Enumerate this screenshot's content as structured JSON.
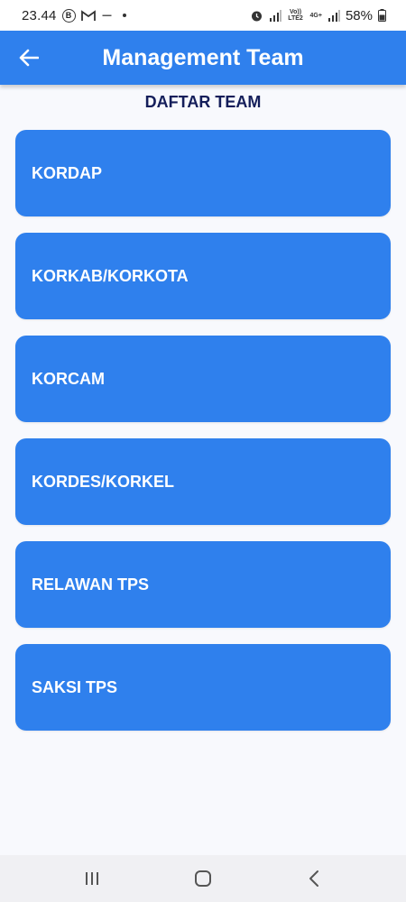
{
  "status_bar": {
    "time": "23.44",
    "app_icons": [
      "b-icon",
      "gmail-icon",
      "notification-icon"
    ],
    "network_label_1": "Vo)) LTE2",
    "network_label_2": "4G+",
    "battery": "58%"
  },
  "app_bar": {
    "title": "Management Team",
    "back_icon": "arrow-left-icon"
  },
  "section": {
    "heading": "DAFTAR TEAM"
  },
  "teams": [
    {
      "label": "KORDAP"
    },
    {
      "label": "KORKAB/KORKOTA"
    },
    {
      "label": "KORCAM"
    },
    {
      "label": "KORDES/KORKEL"
    },
    {
      "label": "RELAWAN TPS"
    },
    {
      "label": "SAKSI TPS"
    }
  ],
  "colors": {
    "primary": "#2f80ed",
    "heading": "#141e5a",
    "background": "#f8f9fd"
  },
  "nav_bar": {
    "buttons": [
      "recent-apps-icon",
      "home-icon",
      "back-icon"
    ]
  }
}
